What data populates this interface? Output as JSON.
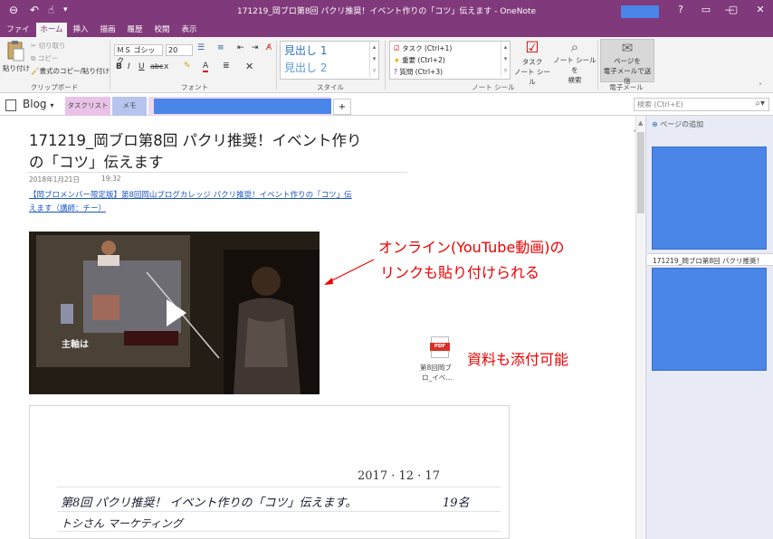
{
  "titlebar": {
    "title": "171219_岡ブロ第8回 パクリ推奨！イベント作りの「コツ」伝えます  -  OneNote",
    "help": "?"
  },
  "menu_tabs": [
    "ファイル",
    "ホーム",
    "挿入",
    "描画",
    "履歴",
    "校閲",
    "表示"
  ],
  "ribbon": {
    "clipboard": {
      "paste": "貼り付け",
      "cut": "切り取り",
      "copy": "コピー",
      "format_painter": "書式のコピー/貼り付け",
      "label": "クリップボード"
    },
    "font": {
      "name": "ＭＳ ゴシック",
      "size": "20",
      "bold": "B",
      "italic": "I",
      "underline": "U",
      "strike": "abc",
      "subscript": "x",
      "label": "フォント"
    },
    "style": {
      "h1": "見出し 1",
      "h2": "見出し 2",
      "label": "スタイル"
    },
    "tags": {
      "todo": "タスク (Ctrl+1)",
      "important": "重要 (Ctrl+2)",
      "question": "質問 (Ctrl+3)",
      "todo_tag_line1": "タスク",
      "todo_tag_line2": "ノート シール",
      "find_tags_line1": "ノート シールを",
      "find_tags_line2": "検索",
      "label": "ノート シール"
    },
    "email": {
      "line1": "ページを",
      "line2": "電子メールで送信",
      "label": "電子メール"
    }
  },
  "notebook": {
    "name": "Blog",
    "sections": [
      "タスクリスト",
      "メモ"
    ],
    "add": "+",
    "search_placeholder": "検索 (Ctrl+E)"
  },
  "page": {
    "title_line1": "171219_岡ブロ第8回 パクリ推奨！イベント作り",
    "title_line2": "の「コツ」伝えます",
    "date": "2018年1月21日",
    "time": "19:32",
    "link_line1": "【岡ブロメンバー限定版】第8回岡山ブログカレッジ パクリ推奨！イベント作りの「コツ」伝",
    "link_line2": "えます（講師：チー）",
    "video_slide_text": "主軸は",
    "annotation_video_line1": "オンライン(YouTube動画)の",
    "annotation_video_line2": "リンクも貼り付けられる",
    "attachment_line1": "第8回岡ブ",
    "attachment_line2": "ロ_イベ…",
    "pdf_badge": "PDF",
    "annotation_attach": "資料も添付可能",
    "handwriting": {
      "date": "2017 · 12 · 17",
      "line1": "第8回 パクリ推奨！ イベント作りの「コツ」伝えます。",
      "count": "19名",
      "line2": "トシさん   マーケティング"
    }
  },
  "pages_pane": {
    "add_page": "ページの追加",
    "page_title": "171219_岡ブロ第8回 パクリ推奨！"
  },
  "colors": {
    "onenote_purple": "#80397b",
    "annotation_red": "#ee0000",
    "thumbnail_blue": "#4a86e8"
  }
}
